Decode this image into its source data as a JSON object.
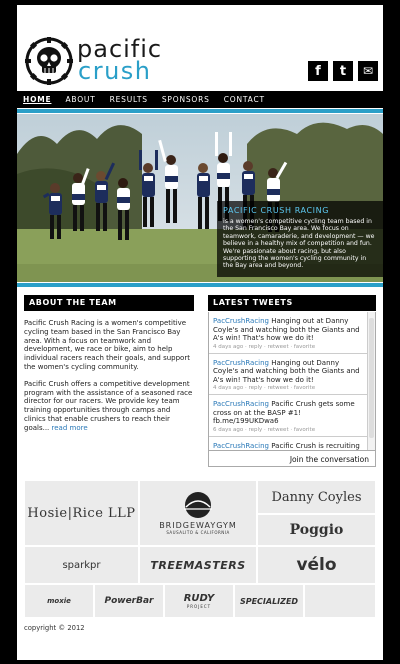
{
  "header": {
    "brand_line1": "pacific",
    "brand_line2": "crush",
    "social": [
      {
        "name": "facebook-icon",
        "glyph": "f"
      },
      {
        "name": "twitter-icon",
        "glyph": "t"
      },
      {
        "name": "email-icon",
        "glyph": "✉"
      }
    ]
  },
  "nav": {
    "items": [
      "HOME",
      "ABOUT",
      "RESULTS",
      "SPONSORS",
      "CONTACT"
    ],
    "active": "HOME"
  },
  "hero": {
    "caption_title": "PACIFIC CRUSH RACING",
    "caption_text": "is a women's competitive cycling team based in the San Francisco Bay area. We focus on teamwork, camaraderie, and development — we believe in a healthy mix of competition and fun. We're passionate about racing, but also supporting the women's cycling community in the Bay area and beyond."
  },
  "about": {
    "heading": "ABOUT THE TEAM",
    "para1": "Pacific Crush Racing is a women's competitive cycling team based in the San Francisco Bay area. With a focus on teamwork and development, we race or bike, aim to help individual racers reach their goals, and support the women's cycling community.",
    "para2": "Pacific Crush offers a competitive development program with the assistance of a seasoned race director for our racers. We provide key team training opportunities through camps and clinics that enable crushers to reach their goals...",
    "read_more": "read more"
  },
  "tweets": {
    "heading": "LATEST TWEETS",
    "items": [
      {
        "user": "PacCrushRacing",
        "text": "Hanging out at Danny Coyle's and watching both the Giants and A's win! That's how we do it!",
        "meta": "4 days ago · reply · retweet · favorite"
      },
      {
        "user": "PacCrushRacing",
        "text": "Hanging out Danny Coyle's and watching both the Giants and A's win! That's how we do it!",
        "meta": "4 days ago · reply · retweet · favorite"
      },
      {
        "user": "PacCrushRacing",
        "text": "Pacific Crush gets some cross on at the BASP #1! fb.me/199UKDwa6",
        "meta": "6 days ago · reply · retweet · favorite"
      },
      {
        "user": "PacCrushRacing",
        "text": "Pacific Crush is recruiting",
        "meta": ""
      }
    ],
    "join": "Join the conversation"
  },
  "sponsors": {
    "hosie": "Hosie|Rice LLP",
    "bridgeway": "BRIDGEWAYGYM",
    "bridgeway_sub": "SAUSALITO & CALIFORNIA",
    "danny": "Danny Coyles",
    "poggio": "Poggio",
    "sparkpr": "sparkpr",
    "treemasters": "TREEMASTERS",
    "velo": "vélo",
    "moxie": "moxie",
    "powerbar": "PowerBar",
    "rudy": "RUDY",
    "rudy_sub": "PROJECT",
    "specialized": "SPECIALIZED"
  },
  "footer": {
    "copyright": "copyright © 2012"
  },
  "colors": {
    "accent": "#2a9fc8",
    "black": "#000000",
    "link": "#2a79b8"
  }
}
